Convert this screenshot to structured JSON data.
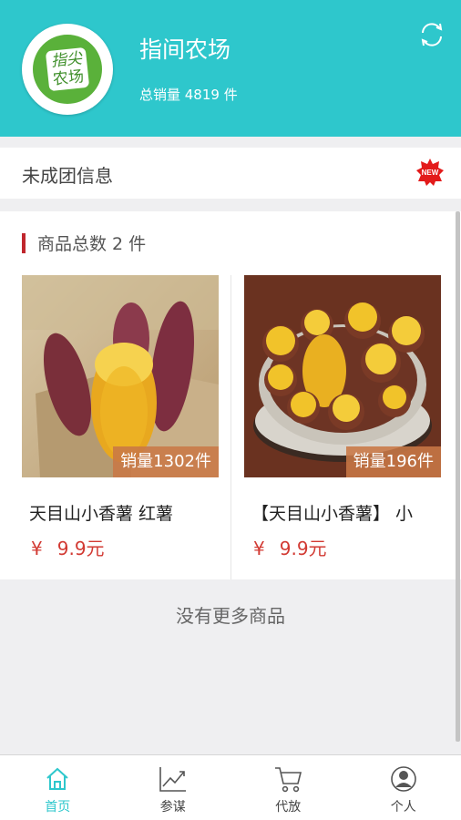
{
  "header": {
    "shop_name": "指间农场",
    "sales_total": "总销量 4819 件",
    "logo_text_1": "指尖",
    "logo_text_2": "农场",
    "refresh_icon": "refresh-icon"
  },
  "info_bar": {
    "label": "未成团信息",
    "badge": "NEW"
  },
  "products_section": {
    "title": "商品总数 2 件"
  },
  "products": [
    {
      "title": "天目山小香薯 红薯",
      "currency": "¥",
      "price": "9.9元",
      "sales": "销量1302件"
    },
    {
      "title": "【天目山小香薯】 小",
      "currency": "¥",
      "price": "9.9元",
      "sales": "销量196件"
    }
  ],
  "no_more_text": "没有更多商品",
  "bottom_nav": [
    {
      "label": "首页",
      "icon": "home-icon",
      "active": true
    },
    {
      "label": "参谋",
      "icon": "trend-chart-icon",
      "active": false
    },
    {
      "label": "代放",
      "icon": "cart-icon",
      "active": false
    },
    {
      "label": "个人",
      "icon": "user-icon",
      "active": false
    }
  ],
  "colors": {
    "accent": "#2ec7cc",
    "price": "#d23a33",
    "section_marker": "#c0262d"
  }
}
